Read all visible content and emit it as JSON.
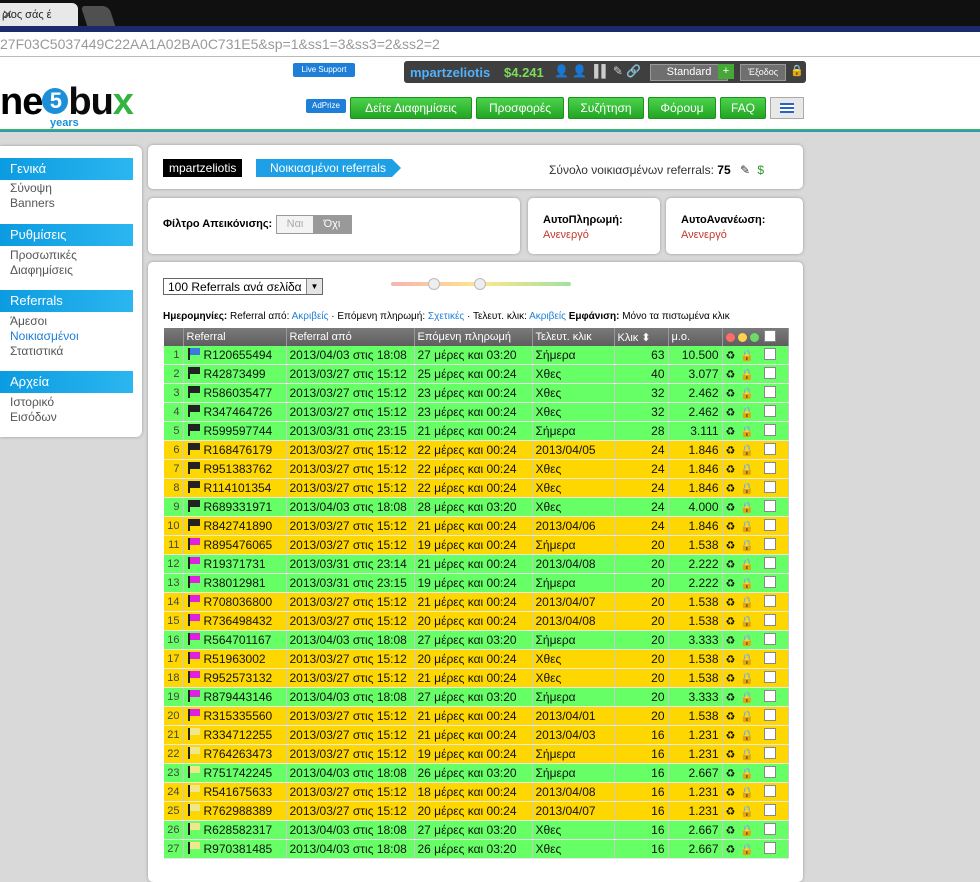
{
  "browser": {
    "tab_title": "ριος σάς έ",
    "address": "27F03C5037449C22AA1A02BA0C731E5&sp=1&ss1=3&ss3=2&ss2=2"
  },
  "header": {
    "logo_left": "ne",
    "logo_five": "5",
    "logo_right": "bu",
    "logo_x": "x",
    "logo_years": "years",
    "live_support": "Live Support",
    "adprize": "AdPrize",
    "username": "mpartzeliotis",
    "balance": "$4.241",
    "membership": "Standard",
    "upgrade": "+",
    "logout": "Έξοδος",
    "nav": [
      "Δείτε Διαφημίσεις",
      "Προσφορές",
      "Συζήτηση",
      "Φόρουμ",
      "FAQ"
    ]
  },
  "sidebar": {
    "sections": [
      {
        "title": "Γενικά",
        "items": [
          "Σύνοψη",
          "Banners"
        ]
      },
      {
        "title": "Ρυθμίσεις",
        "items": [
          "Προσωπικές",
          "Διαφημίσεις"
        ]
      },
      {
        "title": "Referrals",
        "items": [
          "Άμεσοι",
          "Νοικιασμένοι",
          "Στατιστικά"
        ]
      },
      {
        "title": "Αρχεία",
        "items": [
          "Ιστορικό",
          "Εισόδων"
        ]
      }
    ],
    "active_item": "Νοικιασμένοι"
  },
  "breadcrumb": {
    "user": "mpartzeliotis",
    "page": "Νοικιασμένοι referrals",
    "total_label": "Σύνολο νοικιασμένων referrals:",
    "total_value": "75"
  },
  "filter": {
    "label": "Φίλτρο Απεικόνισης:",
    "option_yes": "Ναι",
    "option_no": "Όχι",
    "selected": "Όχι"
  },
  "autopay": {
    "title": "ΑυτοΠληρωμή:",
    "value": "Ανενεργό"
  },
  "autorenew": {
    "title": "ΑυτοΑνανέωση:",
    "value": "Ανενεργό"
  },
  "table_controls": {
    "per_page": "100 Referrals ανά σελίδα",
    "dates_label": "Ημερομηνίες:",
    "ref_from_label": "Referral από:",
    "ref_from_value": "Ακριβείς",
    "next_pay_label": "Επόμενη πληρωμή:",
    "next_pay_value": "Σχετικές",
    "last_click_label": "Τελευτ. κλικ:",
    "last_click_value": "Ακριβείς",
    "show_label": "Εμφάνιση:",
    "show_value": "Μόνο τα πιστωμένα κλικ"
  },
  "table": {
    "headers": [
      "Referral",
      "Referral από",
      "Επόμενη πληρωμή",
      "Τελευτ. κλικ",
      "Κλικ",
      "μ.ο."
    ],
    "colors": {
      "green": "#66ff66",
      "yellow": "#ffd700"
    },
    "rows": [
      {
        "n": "1",
        "flag": "#3b7be0",
        "id": "R120655494",
        "since": "2013/04/03 στις 18:08",
        "next": "27 μέρες και 03:20",
        "last": "Σήμερα",
        "clicks": "63",
        "avg": "10.500",
        "c": "g"
      },
      {
        "n": "2",
        "flag": "#222222",
        "id": "R42873499",
        "since": "2013/03/27 στις 15:12",
        "next": "25 μέρες και 00:24",
        "last": "Χθες",
        "clicks": "40",
        "avg": "3.077",
        "c": "g"
      },
      {
        "n": "3",
        "flag": "#222222",
        "id": "R586035477",
        "since": "2013/03/27 στις 15:12",
        "next": "23 μέρες και 00:24",
        "last": "Χθες",
        "clicks": "32",
        "avg": "2.462",
        "c": "g"
      },
      {
        "n": "4",
        "flag": "#222222",
        "id": "R347464726",
        "since": "2013/03/27 στις 15:12",
        "next": "23 μέρες και 00:24",
        "last": "Χθες",
        "clicks": "32",
        "avg": "2.462",
        "c": "g"
      },
      {
        "n": "5",
        "flag": "#222222",
        "id": "R599597744",
        "since": "2013/03/31 στις 23:15",
        "next": "21 μέρες και 00:24",
        "last": "Σήμερα",
        "clicks": "28",
        "avg": "3.111",
        "c": "g"
      },
      {
        "n": "6",
        "flag": "#222222",
        "id": "R168476179",
        "since": "2013/03/27 στις 15:12",
        "next": "22 μέρες και 00:24",
        "last": "2013/04/05",
        "clicks": "24",
        "avg": "1.846",
        "c": "y"
      },
      {
        "n": "7",
        "flag": "#222222",
        "id": "R951383762",
        "since": "2013/03/27 στις 15:12",
        "next": "22 μέρες και 00:24",
        "last": "Χθες",
        "clicks": "24",
        "avg": "1.846",
        "c": "y"
      },
      {
        "n": "8",
        "flag": "#222222",
        "id": "R114101354",
        "since": "2013/03/27 στις 15:12",
        "next": "22 μέρες και 00:24",
        "last": "Χθες",
        "clicks": "24",
        "avg": "1.846",
        "c": "y"
      },
      {
        "n": "9",
        "flag": "#222222",
        "id": "R689331971",
        "since": "2013/04/03 στις 18:08",
        "next": "28 μέρες και 03:20",
        "last": "Χθες",
        "clicks": "24",
        "avg": "4.000",
        "c": "g"
      },
      {
        "n": "10",
        "flag": "#222222",
        "id": "R842741890",
        "since": "2013/03/27 στις 15:12",
        "next": "21 μέρες και 00:24",
        "last": "2013/04/06",
        "clicks": "24",
        "avg": "1.846",
        "c": "y"
      },
      {
        "n": "11",
        "flag": "#e020e0",
        "id": "R895476065",
        "since": "2013/03/27 στις 15:12",
        "next": "19 μέρες και 00:24",
        "last": "Σήμερα",
        "clicks": "20",
        "avg": "1.538",
        "c": "y"
      },
      {
        "n": "12",
        "flag": "#e020e0",
        "id": "R19371731",
        "since": "2013/03/31 στις 23:14",
        "next": "21 μέρες και 00:24",
        "last": "2013/04/08",
        "clicks": "20",
        "avg": "2.222",
        "c": "g"
      },
      {
        "n": "13",
        "flag": "#e020e0",
        "id": "R38012981",
        "since": "2013/03/31 στις 23:15",
        "next": "19 μέρες και 00:24",
        "last": "Σήμερα",
        "clicks": "20",
        "avg": "2.222",
        "c": "g"
      },
      {
        "n": "14",
        "flag": "#e020e0",
        "id": "R708036800",
        "since": "2013/03/27 στις 15:12",
        "next": "21 μέρες και 00:24",
        "last": "2013/04/07",
        "clicks": "20",
        "avg": "1.538",
        "c": "y"
      },
      {
        "n": "15",
        "flag": "#e020e0",
        "id": "R736498432",
        "since": "2013/03/27 στις 15:12",
        "next": "20 μέρες και 00:24",
        "last": "2013/04/08",
        "clicks": "20",
        "avg": "1.538",
        "c": "y"
      },
      {
        "n": "16",
        "flag": "#e020e0",
        "id": "R564701167",
        "since": "2013/04/03 στις 18:08",
        "next": "27 μέρες και 03:20",
        "last": "Σήμερα",
        "clicks": "20",
        "avg": "3.333",
        "c": "g"
      },
      {
        "n": "17",
        "flag": "#e020e0",
        "id": "R51963002",
        "since": "2013/03/27 στις 15:12",
        "next": "20 μέρες και 00:24",
        "last": "Χθες",
        "clicks": "20",
        "avg": "1.538",
        "c": "y"
      },
      {
        "n": "18",
        "flag": "#e020e0",
        "id": "R952573132",
        "since": "2013/03/27 στις 15:12",
        "next": "21 μέρες και 00:24",
        "last": "Χθες",
        "clicks": "20",
        "avg": "1.538",
        "c": "y"
      },
      {
        "n": "19",
        "flag": "#e020e0",
        "id": "R879443146",
        "since": "2013/04/03 στις 18:08",
        "next": "27 μέρες και 03:20",
        "last": "Σήμερα",
        "clicks": "20",
        "avg": "3.333",
        "c": "g"
      },
      {
        "n": "20",
        "flag": "#e020e0",
        "id": "R315335560",
        "since": "2013/03/27 στις 15:12",
        "next": "21 μέρες και 00:24",
        "last": "2013/04/01",
        "clicks": "20",
        "avg": "1.538",
        "c": "y"
      },
      {
        "n": "21",
        "flag": "#f0e68c",
        "id": "R334712255",
        "since": "2013/03/27 στις 15:12",
        "next": "21 μέρες και 00:24",
        "last": "2013/04/03",
        "clicks": "16",
        "avg": "1.231",
        "c": "y"
      },
      {
        "n": "22",
        "flag": "#f0e68c",
        "id": "R764263473",
        "since": "2013/03/27 στις 15:12",
        "next": "19 μέρες και 00:24",
        "last": "Σήμερα",
        "clicks": "16",
        "avg": "1.231",
        "c": "y"
      },
      {
        "n": "23",
        "flag": "#f0e68c",
        "id": "R751742245",
        "since": "2013/04/03 στις 18:08",
        "next": "26 μέρες και 03:20",
        "last": "Σήμερα",
        "clicks": "16",
        "avg": "2.667",
        "c": "g"
      },
      {
        "n": "24",
        "flag": "#f0e68c",
        "id": "R541675633",
        "since": "2013/03/27 στις 15:12",
        "next": "18 μέρες και 00:24",
        "last": "2013/04/08",
        "clicks": "16",
        "avg": "1.231",
        "c": "y"
      },
      {
        "n": "25",
        "flag": "#f0e68c",
        "id": "R762988389",
        "since": "2013/03/27 στις 15:12",
        "next": "20 μέρες και 00:24",
        "last": "2013/04/07",
        "clicks": "16",
        "avg": "1.231",
        "c": "y"
      },
      {
        "n": "26",
        "flag": "#f0e68c",
        "id": "R628582317",
        "since": "2013/04/03 στις 18:08",
        "next": "27 μέρες και 03:20",
        "last": "Χθες",
        "clicks": "16",
        "avg": "2.667",
        "c": "g"
      },
      {
        "n": "27",
        "flag": "#f0e68c",
        "id": "R970381485",
        "since": "2013/04/03 στις 18:08",
        "next": "26 μέρες και 03:20",
        "last": "Χθες",
        "clicks": "16",
        "avg": "2.667",
        "c": "g"
      }
    ]
  }
}
